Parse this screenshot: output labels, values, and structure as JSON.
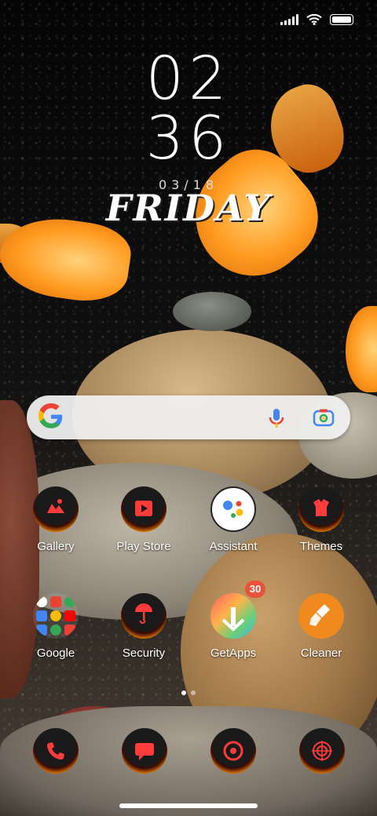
{
  "status_bar": {
    "icons": [
      "signal-icon",
      "wifi-icon",
      "battery-icon"
    ]
  },
  "clock": {
    "hour": "02",
    "minute": "36",
    "date": "03/18",
    "weekday": "FRIDAY"
  },
  "search": {
    "logo": "google-g-icon",
    "actions": [
      "mic-icon",
      "lens-icon"
    ]
  },
  "apps_row1": [
    {
      "label": "Gallery",
      "icon": "gallery-icon"
    },
    {
      "label": "Play Store",
      "icon": "play-store-icon"
    },
    {
      "label": "Assistant",
      "icon": "assistant-icon"
    },
    {
      "label": "Themes",
      "icon": "themes-icon"
    }
  ],
  "apps_row2": [
    {
      "label": "Google",
      "icon": "google-folder-icon"
    },
    {
      "label": "Security",
      "icon": "security-icon"
    },
    {
      "label": "GetApps",
      "icon": "getapps-icon",
      "badge": "30"
    },
    {
      "label": "Cleaner",
      "icon": "cleaner-icon"
    }
  ],
  "page_indicator": {
    "pages": 2,
    "current": 1
  },
  "dock": [
    "phone-icon",
    "messages-icon",
    "browser-icon",
    "camera-icon"
  ],
  "colors": {
    "accent_orange": "#f08a1e",
    "badge_red": "#e8543a"
  }
}
